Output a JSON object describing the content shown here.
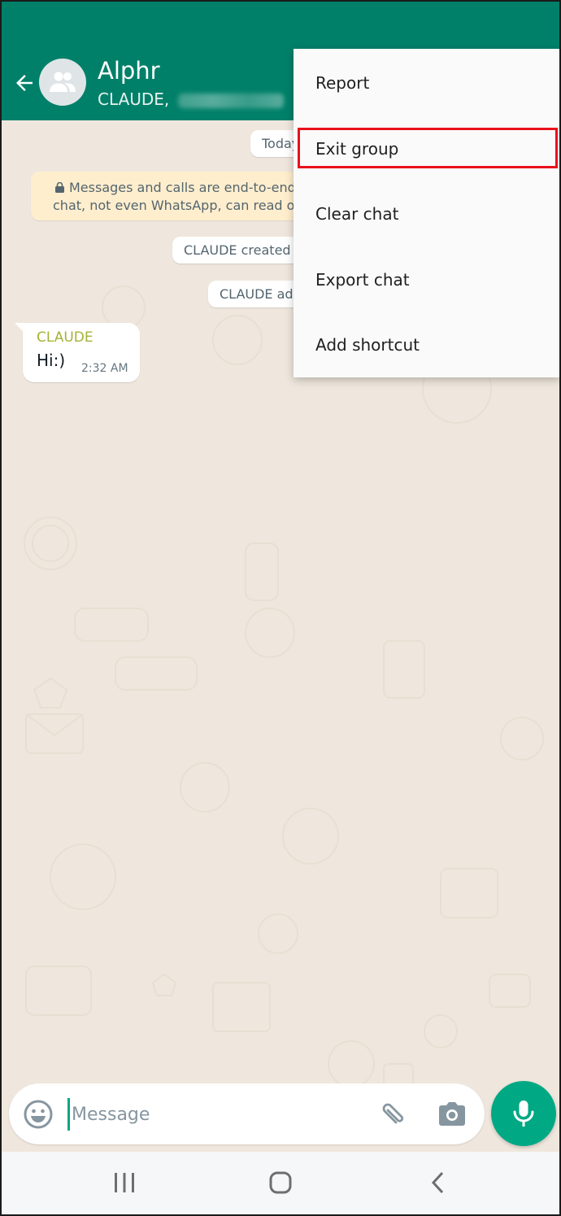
{
  "header": {
    "title": "Alphr",
    "subtitle_prefix": "CLAUDE, ",
    "subtitle_redacted": true,
    "back_icon": "arrow-left-icon",
    "avatar_icon": "group-icon"
  },
  "chat": {
    "date_label": "Today",
    "encryption_notice_line1": "Messages and calls are end-to-end",
    "encryption_notice_line2": "chat, not even WhatsApp, can read or",
    "system_created": "CLAUDE created",
    "system_added": "CLAUDE ad",
    "messages": [
      {
        "sender": "CLAUDE",
        "text": "Hi:)",
        "time": "2:32 AM"
      }
    ]
  },
  "menu": {
    "items": [
      {
        "label": "Report"
      },
      {
        "label": "Exit group",
        "highlighted": true
      },
      {
        "label": "Clear chat"
      },
      {
        "label": "Export chat"
      },
      {
        "label": "Add shortcut"
      }
    ]
  },
  "composer": {
    "placeholder": "Message",
    "value": ""
  },
  "colors": {
    "brand": "#008069",
    "accent": "#00a884",
    "highlight_border": "#e8121c",
    "sender_name": "#a5b337"
  }
}
